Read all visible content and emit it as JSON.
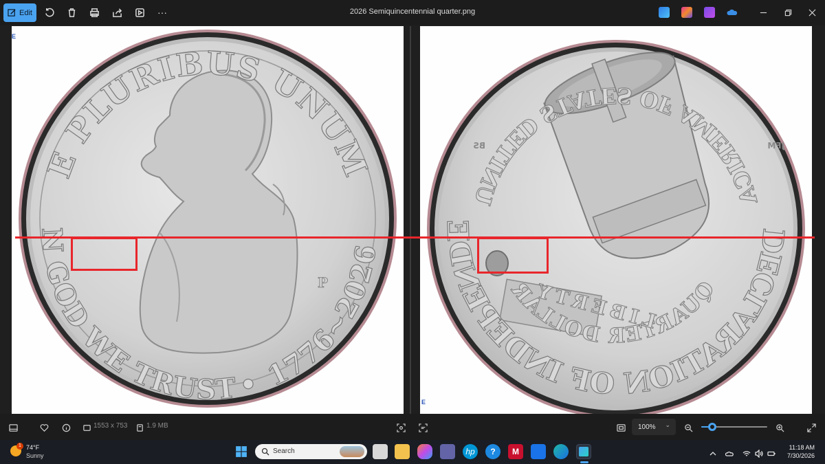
{
  "window": {
    "title": "2026 Semiquincentennial quarter.png",
    "edit_label": "Edit"
  },
  "toolbar": {
    "icons": [
      "rotate-icon",
      "delete-icon",
      "print-icon",
      "share-icon",
      "slideshow-icon",
      "more-icon"
    ],
    "more_glyph": "···"
  },
  "image": {
    "obverse": {
      "top_inscription": "E PLURIBUS UNUM",
      "bottom_inscription": "IN GOD WE TRUST",
      "dates": "1776~2026",
      "separator": "•",
      "mint_mark": "P"
    },
    "reverse": {
      "top_inscription": "UNITED STATES OF AMERICA",
      "bottom_inscription": "THE DECLARATION OF INDEPENDENCE",
      "center_text": "LIBERTY",
      "denomination": "QUARTER DOLLAR",
      "designer_initials_left": "BS",
      "designer_initials_right": "JFM"
    },
    "corner_mark": "E"
  },
  "status": {
    "dimensions": "1553 x 753",
    "file_size": "1.9 MB",
    "zoom_value": "100%",
    "zoom_level": 0.17
  },
  "taskbar": {
    "weather_temp": "74°F",
    "weather_condition": "Sunny",
    "weather_badge": "1",
    "search_placeholder": "Search",
    "time": "11:18 AM",
    "date": "7/30/2026"
  },
  "colors": {
    "accent": "#4aa3f0",
    "annotation_red": "#e8262b"
  }
}
